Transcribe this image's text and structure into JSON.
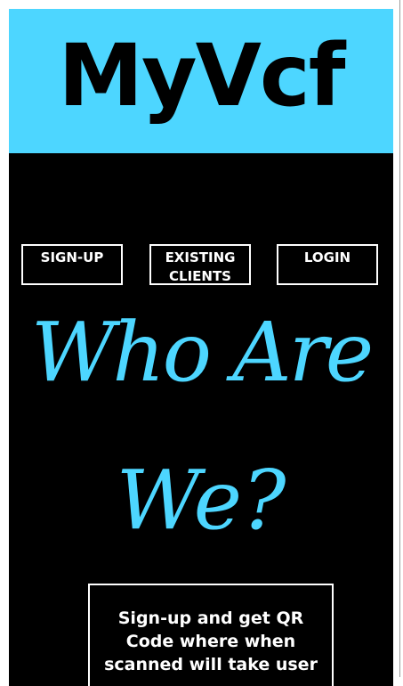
{
  "header": {
    "brand": "MyVcf"
  },
  "nav": {
    "signup_label": "SIGN-UP",
    "existing_label": "EXISTING CLIENTS",
    "login_label": "LOGIN"
  },
  "hero": {
    "line1": "Who Are",
    "line2": "We?"
  },
  "info": {
    "text": "Sign-up and get QR Code where when scanned will take user"
  },
  "colors": {
    "accent": "#4dd6ff",
    "background": "#000000",
    "text": "#ffffff"
  }
}
